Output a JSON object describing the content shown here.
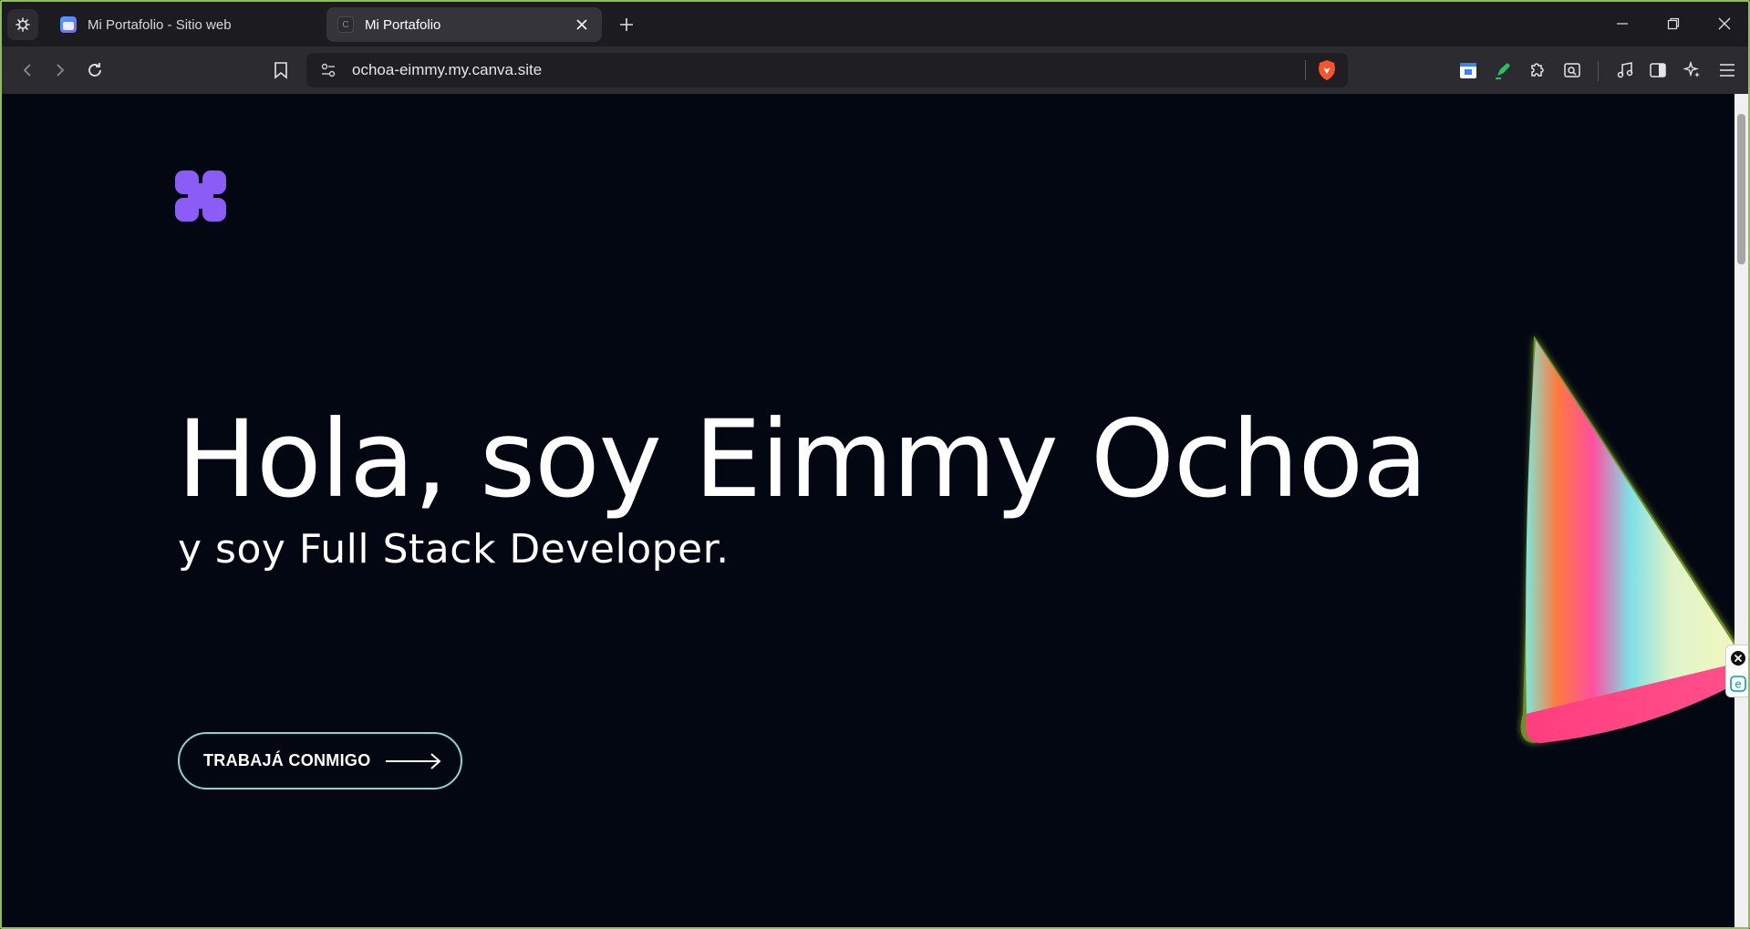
{
  "browser": {
    "tabs": [
      {
        "title": "Mi Portafolio - Sitio web",
        "favicon": "canva-design-icon",
        "active": false
      },
      {
        "title": "Mi Portafolio",
        "favicon": "canva-site-icon",
        "active": true
      }
    ],
    "url": "ochoa-eimmy.my.canva.site",
    "accent_border": "#8bc34a"
  },
  "page": {
    "background": "#030711",
    "logo_color": "#8b5cf6",
    "hero_title": "Hola, soy Eimmy Ochoa",
    "hero_subtitle": "y soy Full Stack Developer.",
    "cta_label": "TRABAJÁ CONMIGO",
    "cta_border": "#8ad6c6"
  }
}
